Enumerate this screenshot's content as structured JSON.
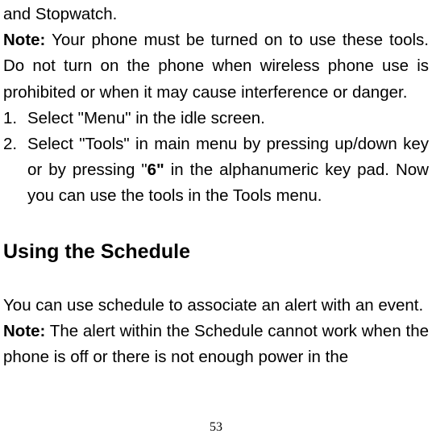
{
  "intro_line": "and Stopwatch.",
  "note1_label": "Note:",
  "note1_body": " Your phone must be turned on to use these tools. Do not turn on the phone when wireless phone use is prohibited or when it may cause interference or danger.",
  "steps": [
    {
      "num": "1.",
      "text": "Select \"Menu\" in the idle screen.",
      "justify": false
    },
    {
      "num": "2.",
      "text_pre": "Select \"Tools\" in main menu by pressing up/down key or by pressing \"",
      "key": "6\"",
      "text_post": " in the alphanumeric key pad. Now you can use the tools in the Tools menu.",
      "justify": true
    }
  ],
  "heading": "Using the Schedule",
  "para2": "You can use schedule to associate an alert with an event.",
  "note2_label": "Note:",
  "note2_body": " The alert within the Schedule cannot work when the phone is off or there is not enough power in the",
  "page_number": "53"
}
